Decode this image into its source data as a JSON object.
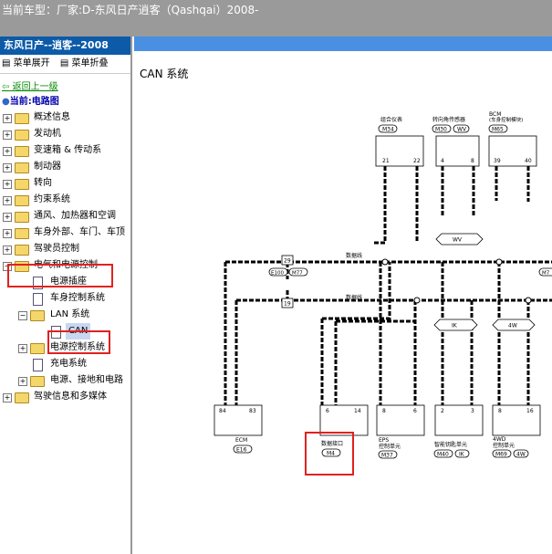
{
  "titlebar": {
    "text": "当前车型：厂家:D-东风日产逍客（Qashqai）2008-"
  },
  "sidebar": {
    "header": "东风日产--逍客--2008",
    "expand_label": "菜单展开",
    "collapse_label": "菜单折叠",
    "back_link": "返回上一级",
    "current": "当前:电路图",
    "tree": [
      {
        "label": "概述信息"
      },
      {
        "label": "发动机"
      },
      {
        "label": "变速箱 & 传动系"
      },
      {
        "label": "制动器"
      },
      {
        "label": "转向"
      },
      {
        "label": "约束系统"
      },
      {
        "label": "通风、加热器和空调"
      },
      {
        "label": "车身外部、车门、车顶"
      },
      {
        "label": "驾驶员控制"
      },
      {
        "label": "电气和电源控制"
      },
      {
        "label": "电源插座"
      },
      {
        "label": "车身控制系统"
      },
      {
        "label": "LAN 系统"
      },
      {
        "label": "CAN"
      },
      {
        "label": "电源控制系统"
      },
      {
        "label": "充电系统"
      },
      {
        "label": "电源、接地和电路"
      },
      {
        "label": "驾驶信息和多媒体"
      }
    ]
  },
  "main": {
    "title": "CAN 系统"
  },
  "diagram": {
    "top_modules": [
      {
        "name": "组合仪表",
        "code": "M34",
        "pins": [
          "21",
          "22"
        ]
      },
      {
        "name": "转向角传感器",
        "code1": "M30",
        "code2": "WV",
        "pins": [
          "4",
          "8"
        ]
      },
      {
        "name1": "BCM",
        "name2": "(车身控制模块)",
        "code": "M65",
        "pins": [
          "39",
          "40"
        ]
      }
    ],
    "bottom_modules": [
      {
        "name": "ECM",
        "code": "E16",
        "pins": [
          "84",
          "83"
        ]
      },
      {
        "name": "数据接口",
        "code": "M4",
        "pins": [
          "6",
          "14"
        ]
      },
      {
        "name1": "EPS",
        "name2": "控制单元",
        "code": "M37",
        "pins": [
          "8",
          "6"
        ]
      },
      {
        "name": "智能钥匙单元",
        "code1": "M40",
        "code2": "IK",
        "pins": [
          "2",
          "3"
        ]
      },
      {
        "name1": "4WD",
        "name2": "控制单元",
        "code1": "M69",
        "code2": "4W",
        "pins": [
          "8",
          "16"
        ]
      }
    ],
    "wire_label_1": "数据线",
    "wire_label_2": "数据线",
    "tag_wv": "WV",
    "tag_ik": "IK",
    "tag_4w": "4W",
    "connector_29": "29",
    "connector_19": "19",
    "connector_e100": "E100",
    "connector_m77": "M77",
    "connector_m7_cut": "M7"
  }
}
